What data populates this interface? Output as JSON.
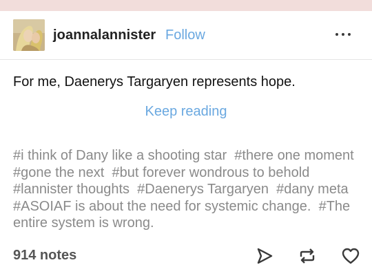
{
  "post": {
    "username": "joannalannister",
    "follow_label": "Follow",
    "body_text": "For me, Daenerys Targaryen represents hope.",
    "keep_reading_label": "Keep reading",
    "tags": [
      "#i think of Dany like a shooting star",
      "#there one moment",
      "#gone the next",
      "#but forever wondrous to behold",
      "#lannister thoughts",
      "#Daenerys Targaryen",
      "#dany meta",
      "#ASOIAF is about the need for systemic change.",
      "#The entire system is wrong."
    ],
    "notes_label": "914 notes"
  },
  "icons": {
    "menu": "more-dots-icon",
    "share": "send-icon",
    "reblog": "reblog-icon",
    "like": "heart-icon"
  },
  "colors": {
    "accent": "#6aa8e0",
    "tag_text": "#8a8a8a",
    "top_strip": "#f2dddb"
  }
}
